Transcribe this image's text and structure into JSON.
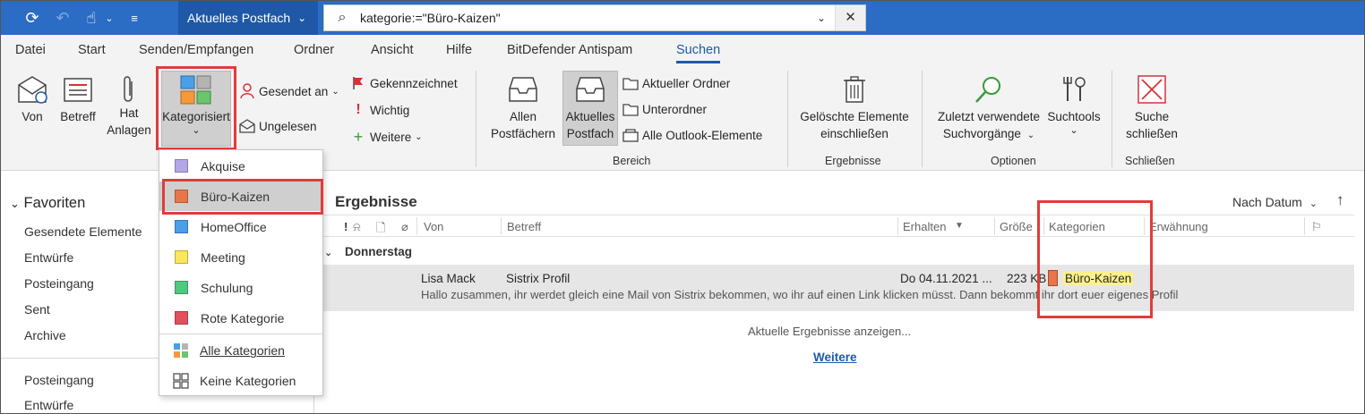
{
  "titlebar": {
    "mailbox_label": "Aktuelles Postfach",
    "search_query": "kategorie:=\"Büro-Kaizen\""
  },
  "tabs": [
    "Datei",
    "Start",
    "Senden/Empfangen",
    "Ordner",
    "Ansicht",
    "Hilfe",
    "BitDefender Antispam",
    "Suchen"
  ],
  "ribbon": {
    "von": "Von",
    "betreff": "Betreff",
    "hat_anlagen_1": "Hat",
    "hat_anlagen_2": "Anlagen",
    "kategorisiert": "Kategorisiert",
    "gesendet_an": "Gesendet an",
    "ungelesen": "Ungelesen",
    "gekennzeichnet": "Gekennzeichnet",
    "wichtig": "Wichtig",
    "weitere": "Weitere",
    "allen_1": "Allen",
    "allen_2": "Postfächern",
    "aktuelles_1": "Aktuelles",
    "aktuelles_2": "Postfach",
    "aktueller_ordner": "Aktueller Ordner",
    "unterordner": "Unterordner",
    "alle_outlook": "Alle Outlook-Elemente",
    "bereich": "Bereich",
    "geloeschte_1": "Gelöschte Elemente",
    "geloeschte_2": "einschließen",
    "ergebnisse": "Ergebnisse",
    "zuletzt_1": "Zuletzt verwendete",
    "zuletzt_2": "Suchvorgänge",
    "suchtools": "Suchtools",
    "optionen": "Optionen",
    "suche_1": "Suche",
    "suche_2": "schließen",
    "schliessen": "Schließen"
  },
  "nav": {
    "favorites": "Favoriten",
    "items": [
      "Gesendete Elemente",
      "Entwürfe",
      "Posteingang",
      "Sent",
      "Archive"
    ],
    "items2": [
      "Posteingang",
      "Entwürfe"
    ]
  },
  "results": {
    "title": "Ergebnisse",
    "sort": "Nach Datum",
    "columns": {
      "von": "Von",
      "betreff": "Betreff",
      "erhalten": "Erhalten",
      "groesse": "Größe",
      "kategorien": "Kategorien",
      "erwaehnung": "Erwähnung"
    },
    "group": "Donnerstag",
    "mail": {
      "from": "Lisa Mack",
      "subject": "Sistrix Profil",
      "received": "Do 04.11.2021 ...",
      "size": "223 KB",
      "category": "Büro-Kaizen",
      "preview": "Hallo zusammen,  ihr werdet gleich eine Mail von Sistrix bekommen, wo ihr auf einen Link klicken müsst.   Dann bekommt ihr dort euer eigenes Profil"
    },
    "show_current": "Aktuelle Ergebnisse anzeigen...",
    "more": "Weitere"
  },
  "dropdown": {
    "categories": [
      {
        "label": "Akquise",
        "color": "#b4a7e8"
      },
      {
        "label": "Büro-Kaizen",
        "color": "#e8764a"
      },
      {
        "label": "HomeOffice",
        "color": "#4a9fe8"
      },
      {
        "label": "Meeting",
        "color": "#fbe65a"
      },
      {
        "label": "Schulung",
        "color": "#4ec97e"
      },
      {
        "label": "Rote Kategorie",
        "color": "#e0505e"
      }
    ],
    "all": "Alle Kategorien",
    "none": "Keine Kategorien"
  }
}
